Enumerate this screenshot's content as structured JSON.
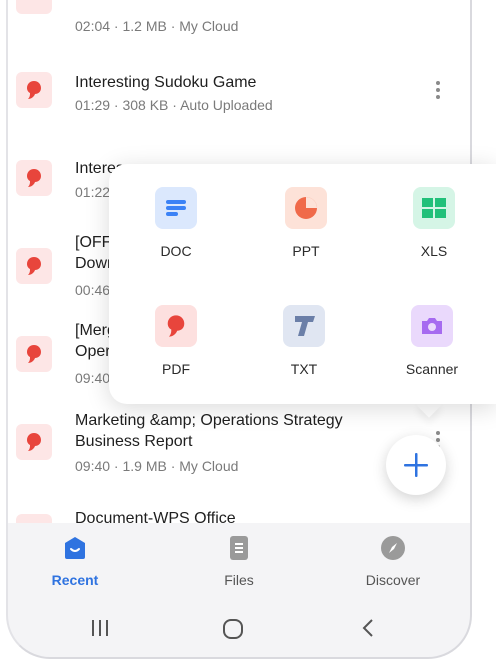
{
  "files": [
    {
      "title": "",
      "meta": "02:04 · 1.2 MB · My Cloud"
    },
    {
      "title": "Interesting Sudoku Game",
      "meta": "01:29 · 308 KB · Auto Uploaded"
    },
    {
      "title": "Interes",
      "meta": "01:22"
    },
    {
      "title_line1": "[OFFI",
      "title_line2": "Down",
      "meta": "00:46"
    },
    {
      "title_line1": "[Merg",
      "title_line2": "Oper",
      "meta": "09:40"
    },
    {
      "title_line1": "Marketing &amp; Operations Strategy",
      "title_line2": "Business Report",
      "meta": "09:40 · 1.9 MB · My Cloud"
    },
    {
      "title": "Document-WPS Office",
      "meta": ""
    }
  ],
  "create_menu": [
    {
      "label": "DOC",
      "icon": "doc-icon",
      "color": "#3b82f6"
    },
    {
      "label": "PPT",
      "icon": "ppt-icon",
      "color": "#f06a4a"
    },
    {
      "label": "XLS",
      "icon": "xls-icon",
      "color": "#22c07a"
    },
    {
      "label": "PDF",
      "icon": "pdf-icon",
      "color": "#e8453c"
    },
    {
      "label": "TXT",
      "icon": "txt-icon",
      "color": "#6b7fa8"
    },
    {
      "label": "Scanner",
      "icon": "camera-icon",
      "color": "#a66bf0"
    }
  ],
  "bottom_nav": [
    {
      "label": "Recent",
      "icon": "recent-icon",
      "active": true
    },
    {
      "label": "Files",
      "icon": "files-icon",
      "active": false
    },
    {
      "label": "Discover",
      "icon": "compass-icon",
      "active": false
    }
  ],
  "colors": {
    "accent": "#2f73e0",
    "pdf_red": "#e8453c"
  }
}
